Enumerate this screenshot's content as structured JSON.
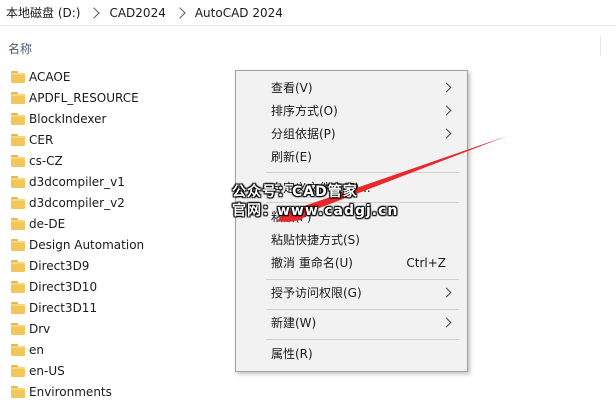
{
  "breadcrumb": [
    "本地磁盘 (D:)",
    "CAD2024",
    "AutoCAD 2024"
  ],
  "column_header": "名称",
  "files": [
    {
      "name": "ACAOE",
      "icon": "folder-icon"
    },
    {
      "name": "APDFL_RESOURCE",
      "icon": "folder-icon"
    },
    {
      "name": "BlockIndexer",
      "icon": "folder-icon"
    },
    {
      "name": "CER",
      "icon": "folder-icon"
    },
    {
      "name": "cs-CZ",
      "icon": "folder-icon"
    },
    {
      "name": "d3dcompiler_v1",
      "icon": "folder-icon"
    },
    {
      "name": "d3dcompiler_v2",
      "icon": "folder-icon"
    },
    {
      "name": "de-DE",
      "icon": "folder-icon"
    },
    {
      "name": "Design Automation",
      "icon": "folder-icon"
    },
    {
      "name": "Direct3D9",
      "icon": "folder-icon"
    },
    {
      "name": "Direct3D10",
      "icon": "folder-icon"
    },
    {
      "name": "Direct3D11",
      "icon": "folder-icon"
    },
    {
      "name": "Drv",
      "icon": "folder-icon"
    },
    {
      "name": "en",
      "icon": "folder-icon"
    },
    {
      "name": "en-US",
      "icon": "folder-icon"
    },
    {
      "name": "Environments",
      "icon": "folder-icon"
    }
  ],
  "context_menu": {
    "items": [
      {
        "label": "查看(V)",
        "submenu": true
      },
      {
        "label": "排序方式(O)",
        "submenu": true
      },
      {
        "label": "分组依据(P)",
        "submenu": true
      },
      {
        "label": "刷新(E)"
      },
      {
        "label": "自定义文件夹(F)..."
      },
      {
        "label": "粘贴(P)"
      },
      {
        "label": "粘贴快捷方式(S)"
      },
      {
        "label": "撤消 重命名(U)",
        "shortcut": "Ctrl+Z"
      },
      {
        "label": "授予访问权限(G)",
        "submenu": true
      },
      {
        "label": "新建(W)",
        "submenu": true
      },
      {
        "label": "属性(R)"
      }
    ]
  },
  "watermark": {
    "line1": "公众号：CAD管家",
    "line2": "官网：www.cadgj.cn"
  },
  "colors": {
    "menu_bg": "#f2f2f2",
    "folder": "#f2c65a",
    "arrow": "#e8282a"
  }
}
